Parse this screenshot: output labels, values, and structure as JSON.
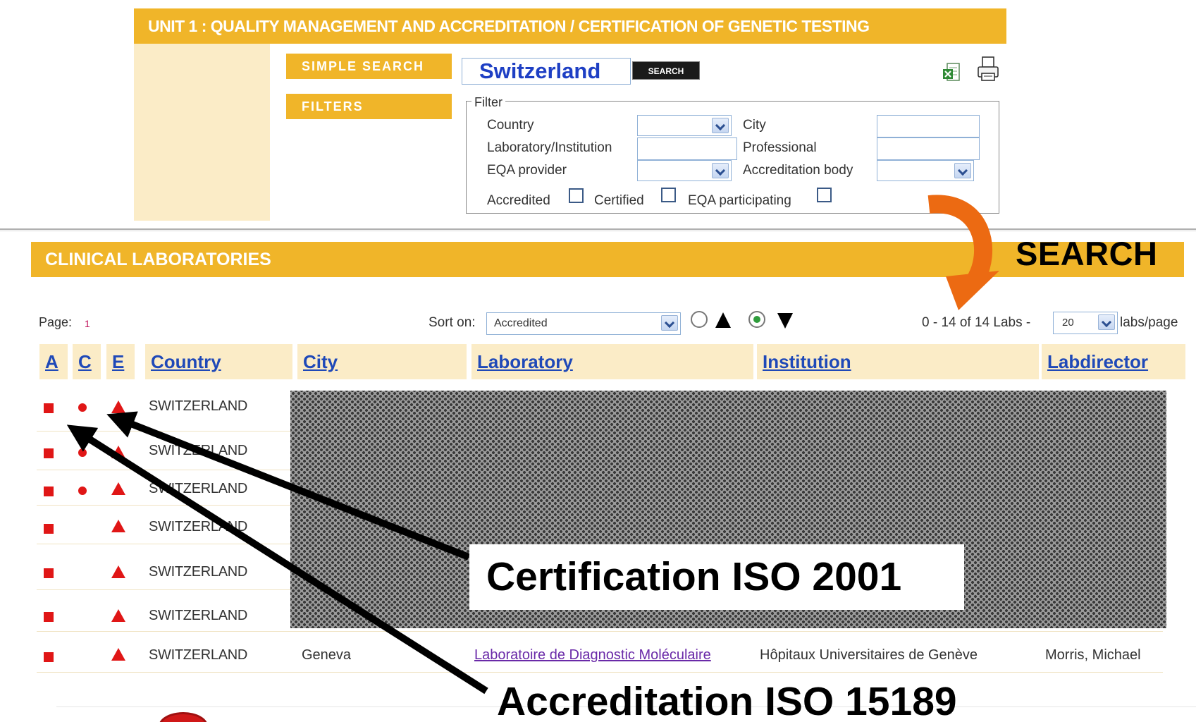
{
  "unit_title": "UNIT 1 : QUALITY MANAGEMENT AND ACCREDITATION / CERTIFICATION OF GENETIC TESTING",
  "sidebar": {
    "simple_search": "SIMPLE SEARCH",
    "filters": "FILTERS"
  },
  "search": {
    "value": "Switzerland",
    "button": "SEARCH"
  },
  "toolbar_icons": [
    "excel-icon",
    "print-icon"
  ],
  "filter": {
    "legend": "Filter",
    "country_label": "Country",
    "city_label": "City",
    "lab_label": "Laboratory/Institution",
    "professional_label": "Professional",
    "eqa_provider_label": "EQA provider",
    "accreditation_body_label": "Accreditation body",
    "accredited_label": "Accredited",
    "certified_label": "Certified",
    "eqa_participating_label": "EQA participating"
  },
  "section_title": "CLINICAL LABORATORIES",
  "controls": {
    "page_label": "Page:",
    "page_number": "1",
    "sort_label": "Sort on:",
    "sort_value": "Accredited",
    "count_text": "0 - 14 of 14 Labs -",
    "per_page_value": "20",
    "per_page_label": "labs/page",
    "sort_direction_selected": "descending"
  },
  "table": {
    "headers": {
      "a": "A",
      "c": "C",
      "e": "E",
      "country": "Country",
      "city": "City",
      "laboratory": "Laboratory",
      "institution": "Institution",
      "labdirector": "Labdirector"
    },
    "rows": [
      {
        "country": "SWITZERLAND",
        "accredited": true,
        "certified": true,
        "eqa": true
      },
      {
        "country": "SWITZERLAND",
        "accredited": true,
        "certified": true,
        "eqa": true
      },
      {
        "country": "SWITZERLAND",
        "accredited": true,
        "certified": true,
        "eqa": true
      },
      {
        "country": "SWITZERLAND",
        "accredited": true,
        "certified": false,
        "eqa": true
      },
      {
        "country": "SWITZERLAND",
        "accredited": true,
        "certified": false,
        "eqa": true
      },
      {
        "country": "SWITZERLAND",
        "accredited": true,
        "certified": false,
        "eqa": true
      },
      {
        "country": "SWITZERLAND",
        "accredited": true,
        "certified": false,
        "eqa": true,
        "city": "Geneva",
        "laboratory": "Laboratoire de Diagnostic Moléculaire",
        "institution": "Hôpitaux Universitaires de Genève",
        "labdirector": "Morris, Michael"
      }
    ]
  },
  "annotations": {
    "search": "SEARCH",
    "certification": "Certification ISO 2001",
    "accreditation": "Accreditation ISO 15189"
  },
  "colors": {
    "accent": "#f0b529",
    "accent_light": "#fbecc7",
    "marker_red": "#e01616",
    "link_blue": "#1f49b8",
    "orange_arrow": "#ec6a12"
  }
}
